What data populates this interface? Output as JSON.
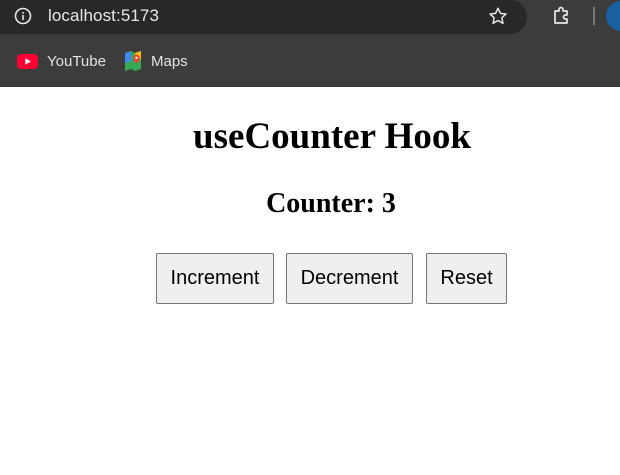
{
  "browser": {
    "url": "localhost:5173",
    "bookmarks": [
      {
        "label": "YouTube",
        "icon": "youtube-icon",
        "color": "#ff0033"
      },
      {
        "label": "Maps",
        "icon": "maps-icon"
      }
    ]
  },
  "page": {
    "title": "useCounter Hook",
    "counter_label": "Counter:",
    "counter_value": 3,
    "counter_text": "Counter: 3",
    "buttons": {
      "increment": "Increment",
      "decrement": "Decrement",
      "reset": "Reset"
    }
  }
}
